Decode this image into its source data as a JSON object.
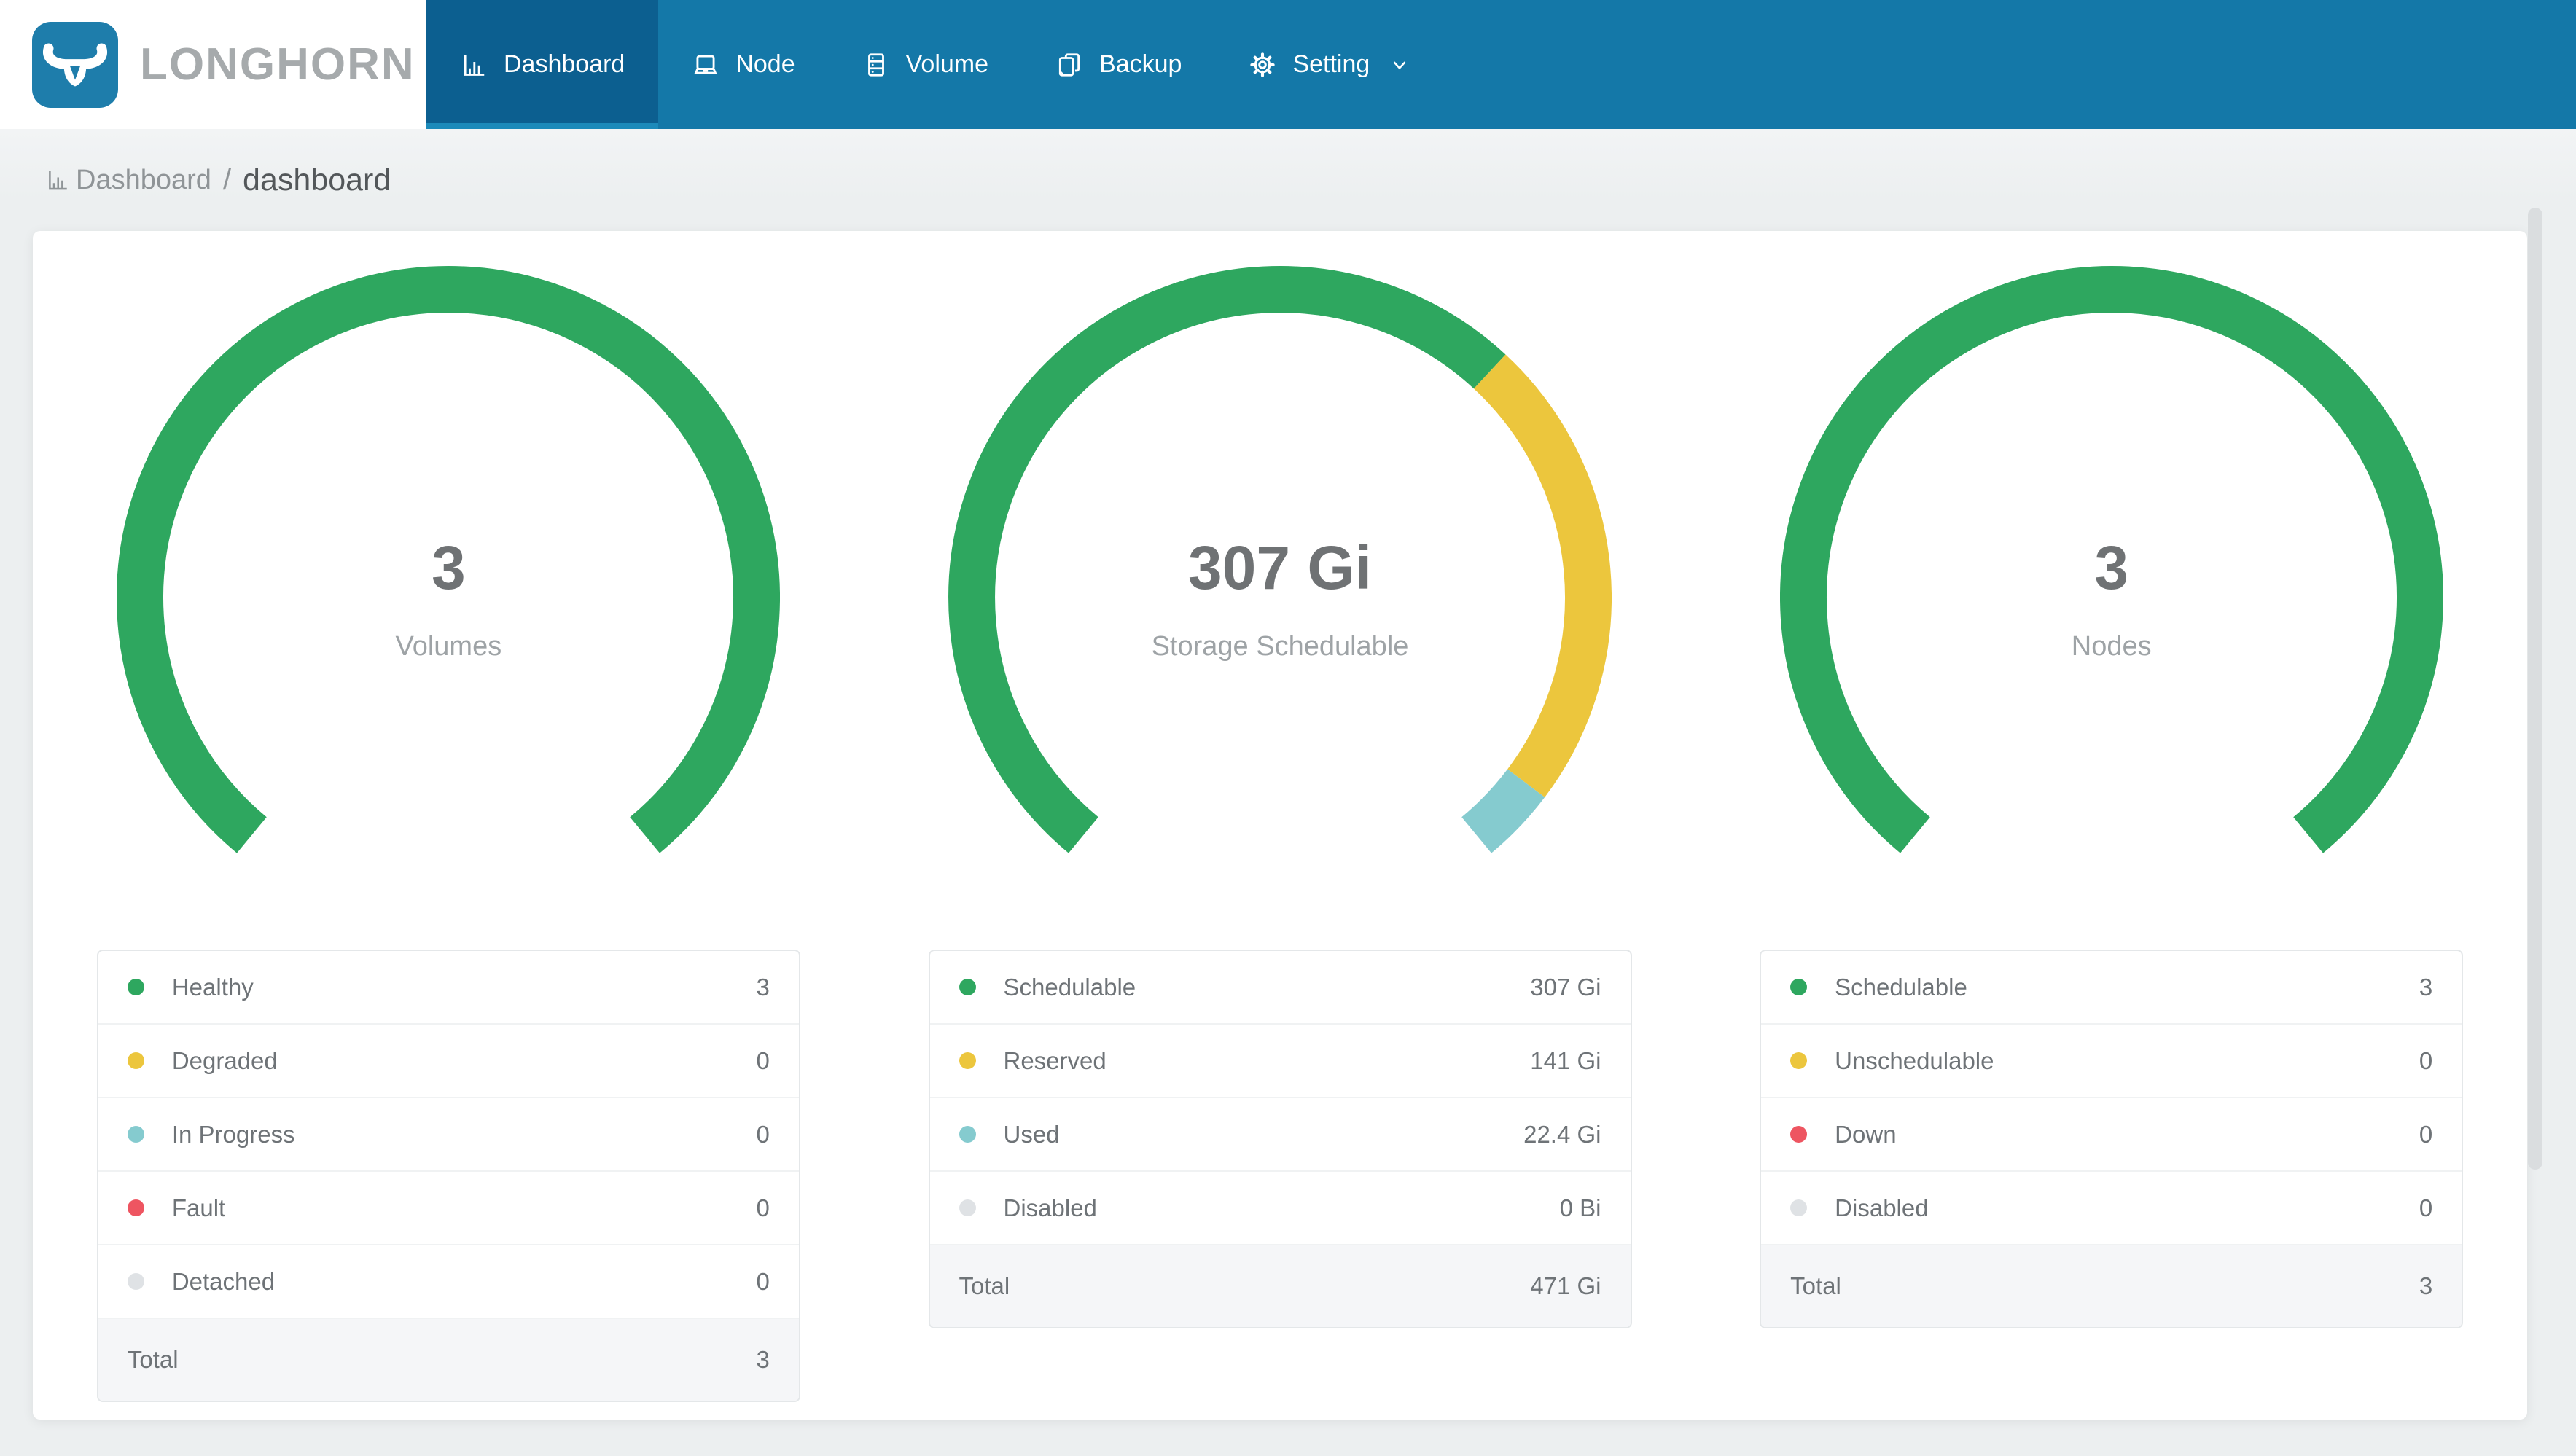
{
  "app": {
    "name": "LONGHORN"
  },
  "navbar": {
    "items": [
      {
        "label": "Dashboard",
        "active": true
      },
      {
        "label": "Node",
        "active": false
      },
      {
        "label": "Volume",
        "active": false
      },
      {
        "label": "Backup",
        "active": false
      },
      {
        "label": "Setting",
        "active": false,
        "has_dropdown": true
      }
    ]
  },
  "breadcrumb": {
    "section": "Dashboard",
    "separator": "/",
    "page": "dashboard"
  },
  "colors": {
    "navbar-bg": "#1478A8",
    "navbar-active-bg": "#0C5F90",
    "navbar-active-border": "#1C8ABA",
    "logo-bg": "#1E7DAB",
    "wordmark": "#A6AAAC",
    "green": "#2EA75F",
    "yellow": "#ECC63D",
    "teal": "#85CBCF",
    "red": "#EE5561",
    "gray": "#DFE2E5"
  },
  "gauge_geometry": {
    "start_angle_deg": 129.6,
    "sweep_deg": 280.8,
    "stroke_width": 64
  },
  "panels": [
    {
      "center_value": "3",
      "center_caption": "Volumes",
      "rows": [
        {
          "label": "Healthy",
          "value": "3",
          "num": 3,
          "color": "green"
        },
        {
          "label": "Degraded",
          "value": "0",
          "num": 0,
          "color": "yellow"
        },
        {
          "label": "In Progress",
          "value": "0",
          "num": 0,
          "color": "teal"
        },
        {
          "label": "Fault",
          "value": "0",
          "num": 0,
          "color": "red"
        },
        {
          "label": "Detached",
          "value": "0",
          "num": 0,
          "color": "gray"
        }
      ],
      "total_label": "Total",
      "total_value": "3"
    },
    {
      "center_value": "307 Gi",
      "center_caption": "Storage Schedulable",
      "rows": [
        {
          "label": "Schedulable",
          "value": "307 Gi",
          "num": 307,
          "color": "green"
        },
        {
          "label": "Reserved",
          "value": "141 Gi",
          "num": 141,
          "color": "yellow"
        },
        {
          "label": "Used",
          "value": "22.4 Gi",
          "num": 22.4,
          "color": "teal"
        },
        {
          "label": "Disabled",
          "value": "0 Bi",
          "num": 0,
          "color": "gray"
        }
      ],
      "total_label": "Total",
      "total_value": "471 Gi"
    },
    {
      "center_value": "3",
      "center_caption": "Nodes",
      "rows": [
        {
          "label": "Schedulable",
          "value": "3",
          "num": 3,
          "color": "green"
        },
        {
          "label": "Unschedulable",
          "value": "0",
          "num": 0,
          "color": "yellow"
        },
        {
          "label": "Down",
          "value": "0",
          "num": 0,
          "color": "red"
        },
        {
          "label": "Disabled",
          "value": "0",
          "num": 0,
          "color": "gray"
        }
      ],
      "total_label": "Total",
      "total_value": "3"
    }
  ]
}
